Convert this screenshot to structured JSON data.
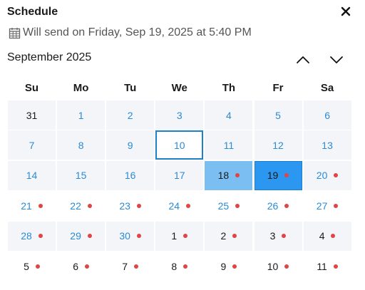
{
  "dialog": {
    "title": "Schedule",
    "close_icon": "close-icon",
    "calendar_icon": "calendar-icon",
    "send_text": "Will send on Friday, Sep 19, 2025 at 5:40 PM"
  },
  "calendar": {
    "month_label": "September 2025",
    "prev_icon": "chevron-up-icon",
    "next_icon": "chevron-down-icon",
    "weekdays": [
      "Su",
      "Mo",
      "Tu",
      "We",
      "Th",
      "Fr",
      "Sa"
    ],
    "dot_color": "#e04545",
    "accent_color": "#2b97f0",
    "weeks": [
      [
        {
          "label": "31",
          "style": "dark",
          "tint": true,
          "dot": false
        },
        {
          "label": "1",
          "style": "blue",
          "tint": true,
          "dot": false
        },
        {
          "label": "2",
          "style": "blue",
          "tint": true,
          "dot": false
        },
        {
          "label": "3",
          "style": "blue",
          "tint": true,
          "dot": false
        },
        {
          "label": "4",
          "style": "blue",
          "tint": true,
          "dot": false
        },
        {
          "label": "5",
          "style": "blue",
          "tint": true,
          "dot": false
        },
        {
          "label": "6",
          "style": "blue",
          "tint": true,
          "dot": false
        }
      ],
      [
        {
          "label": "7",
          "style": "blue",
          "tint": true,
          "dot": false
        },
        {
          "label": "8",
          "style": "blue",
          "tint": true,
          "dot": false
        },
        {
          "label": "9",
          "style": "blue",
          "tint": true,
          "dot": false
        },
        {
          "label": "10",
          "style": "today",
          "tint": false,
          "dot": false
        },
        {
          "label": "11",
          "style": "blue",
          "tint": true,
          "dot": false
        },
        {
          "label": "12",
          "style": "blue",
          "tint": true,
          "dot": false
        },
        {
          "label": "13",
          "style": "blue",
          "tint": true,
          "dot": false
        }
      ],
      [
        {
          "label": "14",
          "style": "blue",
          "tint": true,
          "dot": false
        },
        {
          "label": "15",
          "style": "blue",
          "tint": true,
          "dot": false
        },
        {
          "label": "16",
          "style": "blue",
          "tint": true,
          "dot": false
        },
        {
          "label": "17",
          "style": "blue",
          "tint": true,
          "dot": false
        },
        {
          "label": "18",
          "style": "sel-light",
          "tint": false,
          "dot": true
        },
        {
          "label": "19",
          "style": "sel",
          "tint": false,
          "dot": true
        },
        {
          "label": "20",
          "style": "blue",
          "tint": true,
          "dot": true
        }
      ],
      [
        {
          "label": "21",
          "style": "blue",
          "tint": false,
          "dot": true
        },
        {
          "label": "22",
          "style": "blue",
          "tint": false,
          "dot": true
        },
        {
          "label": "23",
          "style": "blue",
          "tint": false,
          "dot": true
        },
        {
          "label": "24",
          "style": "blue",
          "tint": false,
          "dot": true
        },
        {
          "label": "25",
          "style": "blue",
          "tint": false,
          "dot": true
        },
        {
          "label": "26",
          "style": "blue",
          "tint": false,
          "dot": true
        },
        {
          "label": "27",
          "style": "blue",
          "tint": false,
          "dot": true
        }
      ],
      [
        {
          "label": "28",
          "style": "blue",
          "tint": true,
          "dot": true
        },
        {
          "label": "29",
          "style": "blue",
          "tint": true,
          "dot": true
        },
        {
          "label": "30",
          "style": "blue",
          "tint": true,
          "dot": true
        },
        {
          "label": "1",
          "style": "dark",
          "tint": true,
          "dot": true
        },
        {
          "label": "2",
          "style": "dark",
          "tint": true,
          "dot": true
        },
        {
          "label": "3",
          "style": "dark",
          "tint": true,
          "dot": true
        },
        {
          "label": "4",
          "style": "dark",
          "tint": true,
          "dot": true
        }
      ],
      [
        {
          "label": "5",
          "style": "dark",
          "tint": false,
          "dot": true
        },
        {
          "label": "6",
          "style": "dark",
          "tint": false,
          "dot": true
        },
        {
          "label": "7",
          "style": "dark",
          "tint": false,
          "dot": true
        },
        {
          "label": "8",
          "style": "dark",
          "tint": false,
          "dot": true
        },
        {
          "label": "9",
          "style": "dark",
          "tint": false,
          "dot": true
        },
        {
          "label": "10",
          "style": "dark",
          "tint": false,
          "dot": true
        },
        {
          "label": "11",
          "style": "dark",
          "tint": false,
          "dot": true
        }
      ]
    ]
  }
}
